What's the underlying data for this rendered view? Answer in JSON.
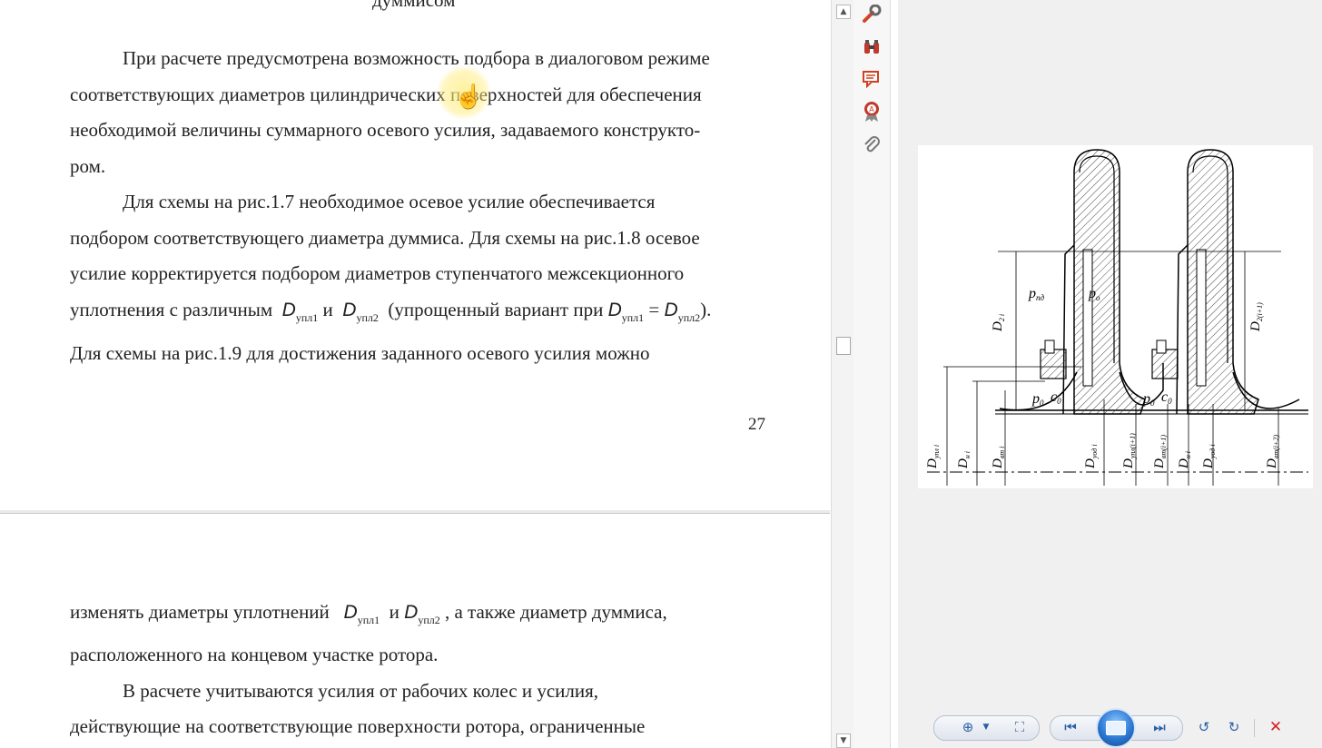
{
  "document": {
    "page1": {
      "top_fragment": "думмисом",
      "lines": [
        "При расчете предусмотрена возможность подбора в диалоговом режиме",
        "соответствующих диаметров цилиндрических поверхностей для обеспечения",
        "необходимой величины суммарного осевого усилия, задаваемого конструкто-",
        "ром.",
        "Для схемы на рис.1.7 необходимое осевое усилие обеспечивается",
        "подбором соответствующего диаметра думмиса. Для схемы на рис.1.8 осевое",
        "усилие корректируется подбором диаметров ступенчатого межсекционного"
      ],
      "line8": {
        "text_a": "уплотнения с различным",
        "d": "D",
        "sub1": "упл1",
        "and": "и",
        "sub2": "упл2",
        "text_b": "(упрощенный вариант при",
        "eq": "=",
        "close": ")."
      },
      "line9": "Для схемы на рис.1.9 для достижения заданного осевого усилия можно",
      "page_number": "27"
    },
    "page2": {
      "line1": {
        "text_a": "изменять диаметры уплотнений",
        "d": "D",
        "sub1": "упл1",
        "and": "и",
        "sub2": "упл2",
        "text_b": ", а также диаметр думмиса,"
      },
      "lines": [
        "расположенного на концевом участке ротора.",
        "В расчете учитываются усилия от рабочих колес и усилия,",
        "действующие на соответствующие поверхности ротора, ограниченные"
      ]
    }
  },
  "tools": [
    {
      "icon": "wrench-icon",
      "color": "#d2442a"
    },
    {
      "icon": "binoculars-icon",
      "color": "#c0392b"
    },
    {
      "icon": "comment-icon",
      "color": "#d04020"
    },
    {
      "icon": "stamp-icon",
      "color": "#c0392b"
    },
    {
      "icon": "paperclip-icon",
      "color": "#777777"
    }
  ],
  "figure": {
    "labels": {
      "p_pd": "p",
      "p_pd_sub": "пд",
      "p_o": "p",
      "p_o_sub": "о",
      "p0": "p",
      "p0_sub": "0",
      "c0": "c",
      "c0_sub": "0",
      "p0b": "p",
      "p0b_sub": "0",
      "c0b": "c",
      "c0b_sub": "0",
      "D2i": "D",
      "D2i_sub": "2 i",
      "D2i1": "D",
      "D2i1_sub": "2(i+1)",
      "Dupli": "D",
      "Dupli_sub": "упл i",
      "Dni": "D",
      "Dni_sub": "н i",
      "Dvti": "D",
      "Dvti_sub": "вт i",
      "Duodi": "D",
      "Duodi_sub": "уод i",
      "Dupli1": "D",
      "Dupli1_sub": "упл(i+1)",
      "Dvti1": "D",
      "Dvti1_sub": "вт(i+1)",
      "Dni2": "D",
      "Dni2_sub": "н i",
      "Duodi2": "D",
      "Duodi2_sub": "уод i",
      "Dvti2": "D",
      "Dvti2_sub": "вт(i+2)"
    }
  },
  "colors": {
    "accent_blue": "#2a78d3",
    "close_red": "#d62222",
    "page_bg": "#ffffff",
    "pane_bg": "#f0f0f0"
  }
}
